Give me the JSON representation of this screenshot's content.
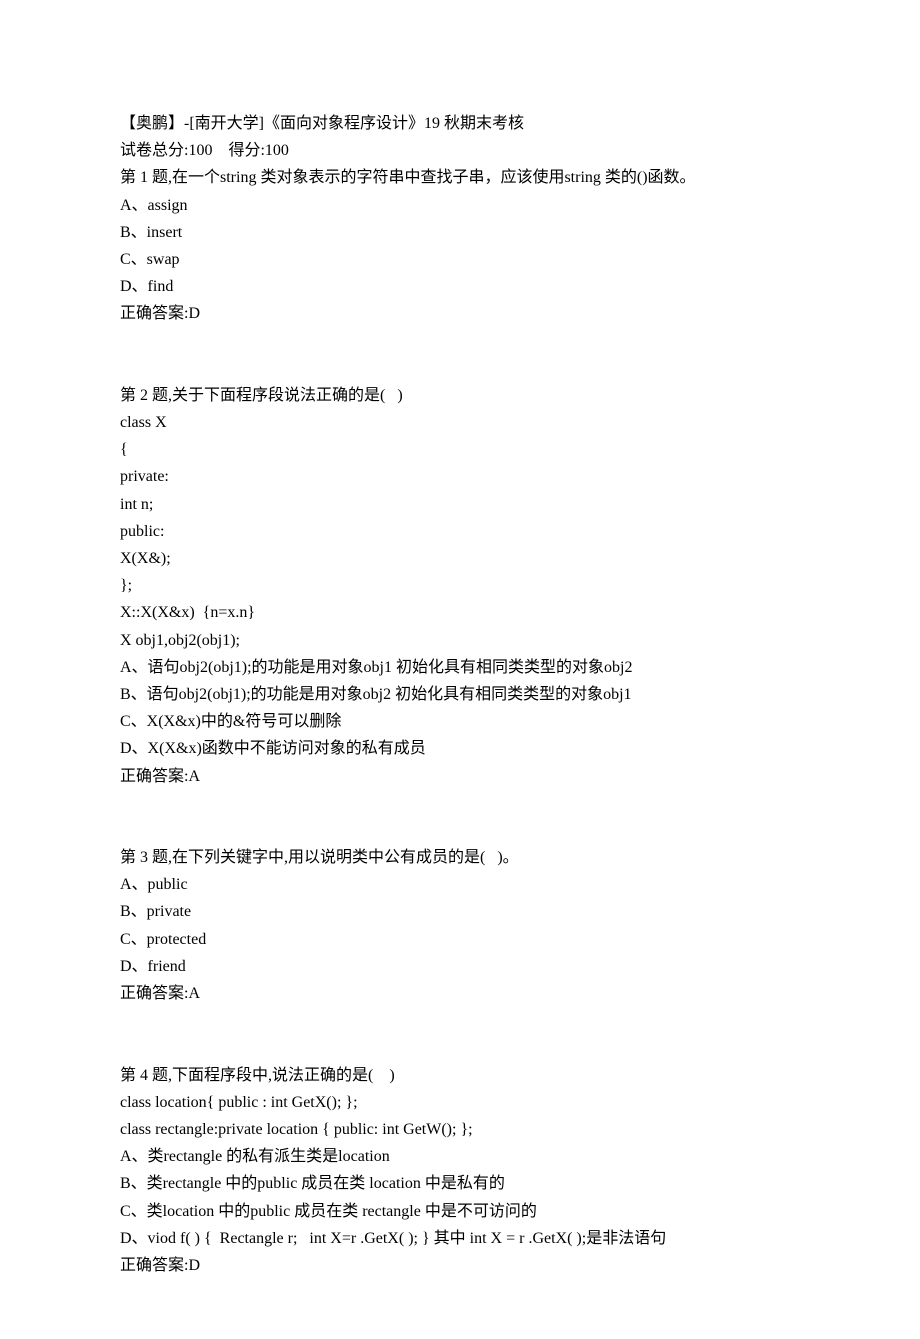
{
  "header": {
    "title": "【奥鹏】-[南开大学]《面向对象程序设计》19 秋期末考核",
    "score_line": "试卷总分:100    得分:100"
  },
  "questions": [
    {
      "prompt_lines": [
        "第 1 题,在一个string 类对象表示的字符串中查找子串，应该使用string 类的()函数。"
      ],
      "options": [
        "A、assign",
        "B、insert",
        "C、swap",
        "D、find"
      ],
      "answer": "正确答案:D"
    },
    {
      "prompt_lines": [
        "第 2 题,关于下面程序段说法正确的是(   )",
        "class X",
        "{",
        "private:",
        "int n;",
        "public:",
        "X(X&);",
        "};",
        "X::X(X&x)  {n=x.n}",
        "X obj1,obj2(obj1);"
      ],
      "options": [
        "A、语句obj2(obj1);的功能是用对象obj1 初始化具有相同类类型的对象obj2",
        "B、语句obj2(obj1);的功能是用对象obj2 初始化具有相同类类型的对象obj1",
        "C、X(X&x)中的&符号可以删除",
        "D、X(X&x)函数中不能访问对象的私有成员"
      ],
      "answer": "正确答案:A"
    },
    {
      "prompt_lines": [
        "第 3 题,在下列关键字中,用以说明类中公有成员的是(   )。"
      ],
      "options": [
        "A、public",
        "B、private",
        "C、protected",
        "D、friend"
      ],
      "answer": "正确答案:A"
    },
    {
      "prompt_lines": [
        "第 4 题,下面程序段中,说法正确的是(    )",
        "class location{ public : int GetX(); };",
        "class rectangle:private location { public: int GetW(); };"
      ],
      "options": [
        "A、类rectangle 的私有派生类是location",
        "B、类rectangle 中的public 成员在类 location 中是私有的",
        "C、类location 中的public 成员在类 rectangle 中是不可访问的",
        "D、viod f( ) {  Rectangle r;   int X=r .GetX( ); } 其中 int X = r .GetX( );是非法语句"
      ],
      "answer": "正确答案:D"
    }
  ]
}
